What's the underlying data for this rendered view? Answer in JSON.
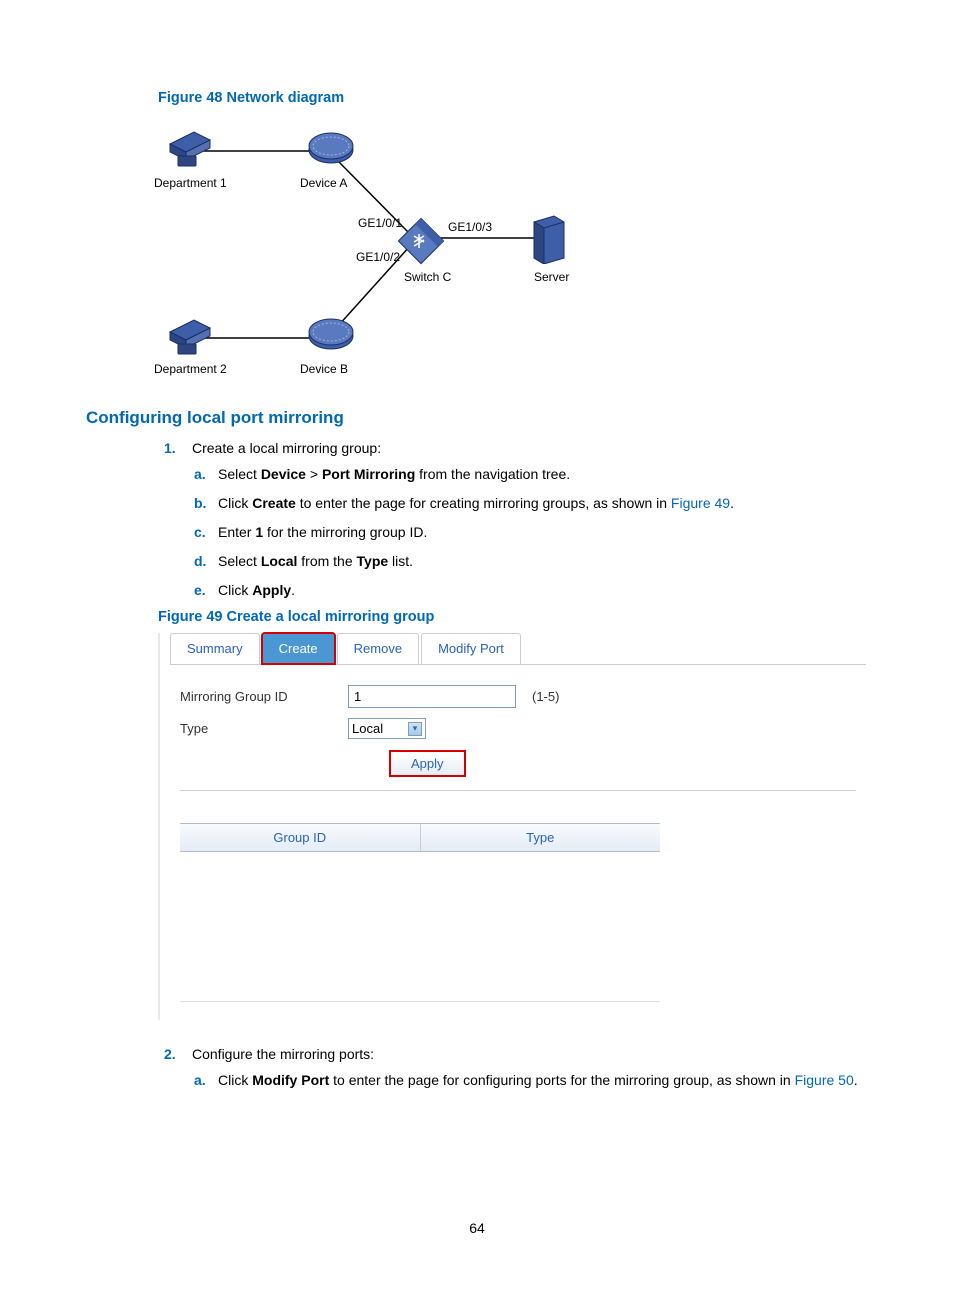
{
  "figure48": {
    "caption": "Figure 48 Network diagram",
    "labels": {
      "dept1": "Department 1",
      "dept2": "Department 2",
      "devA": "Device A",
      "devB": "Device B",
      "switchC": "Switch C",
      "server": "Server",
      "ge101": "GE1/0/1",
      "ge102": "GE1/0/2",
      "ge103": "GE1/0/3"
    }
  },
  "section_heading": "Configuring local port mirroring",
  "step1": {
    "marker": "1.",
    "text": "Create a local mirroring group:"
  },
  "sub1": {
    "a": {
      "m": "a.",
      "pre": "Select ",
      "b1": "Device",
      "gt": " > ",
      "b2": "Port Mirroring",
      "post": " from the navigation tree."
    },
    "b": {
      "m": "b.",
      "pre": "Click ",
      "b1": "Create",
      "mid": " to enter the page for creating mirroring groups, as shown in ",
      "link": "Figure 49",
      "post": "."
    },
    "c": {
      "m": "c.",
      "pre": "Enter ",
      "b1": "1",
      "post": " for the mirroring group ID."
    },
    "d": {
      "m": "d.",
      "pre": "Select ",
      "b1": "Local",
      "mid": " from the ",
      "b2": "Type",
      "post": " list."
    },
    "e": {
      "m": "e.",
      "pre": "Click ",
      "b1": "Apply",
      "post": "."
    }
  },
  "figure49": {
    "caption": "Figure 49 Create a local mirroring group"
  },
  "ui": {
    "tabs": {
      "summary": "Summary",
      "create": "Create",
      "remove": "Remove",
      "modify": "Modify Port"
    },
    "form": {
      "group_id_label": "Mirroring Group ID",
      "group_id_value": "1",
      "range": "(1-5)",
      "type_label": "Type",
      "type_value": "Local",
      "apply": "Apply"
    },
    "table": {
      "col1": "Group ID",
      "col2": "Type"
    }
  },
  "step2": {
    "marker": "2.",
    "text": "Configure the mirroring ports:"
  },
  "sub2": {
    "a": {
      "m": "a.",
      "pre": "Click ",
      "b1": "Modify Port",
      "mid": " to enter the page for configuring ports for the mirroring group, as shown in ",
      "link": "Figure 50",
      "post": "."
    }
  },
  "page_number": "64"
}
